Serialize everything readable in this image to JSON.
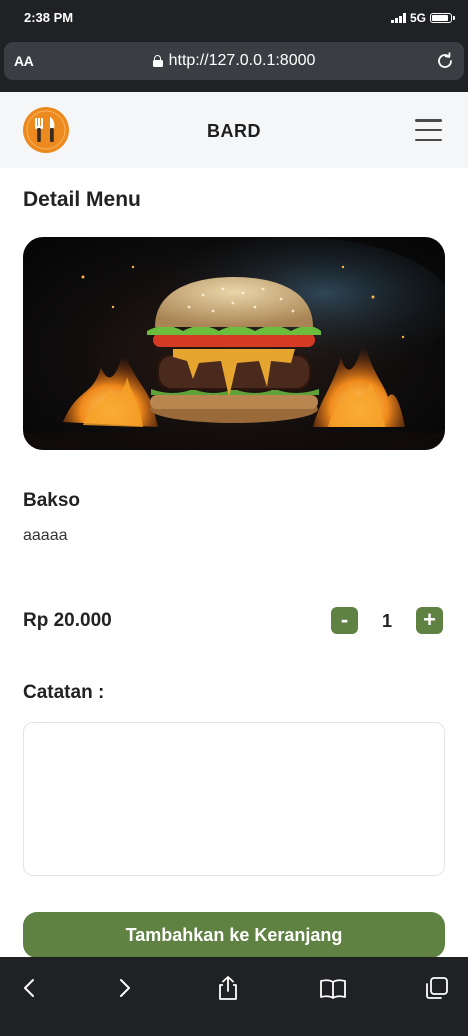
{
  "status_bar": {
    "time": "2:38 PM",
    "network": "5G",
    "battery_level": 0.9
  },
  "browser": {
    "aa_label": "AA",
    "url": "http://127.0.0.1:8000"
  },
  "header": {
    "brand": "BARD"
  },
  "main": {
    "title": "Detail Menu",
    "item": {
      "name": "Bakso",
      "description": "aaaaa",
      "price": "Rp 20.000"
    },
    "quantity": {
      "minus_label": "-",
      "value": "1",
      "plus_label": "+"
    },
    "notes": {
      "label": "Catatan :",
      "value": ""
    },
    "add_button_label": "Tambahkan ke Keranjang"
  },
  "colors": {
    "accent": "#5f8142",
    "logo": "#ec8a1f",
    "browser_chrome": "#1f2124"
  },
  "toolbar": {
    "icons": [
      "back-icon",
      "forward-icon",
      "share-icon",
      "bookmarks-icon",
      "tabs-icon"
    ]
  }
}
